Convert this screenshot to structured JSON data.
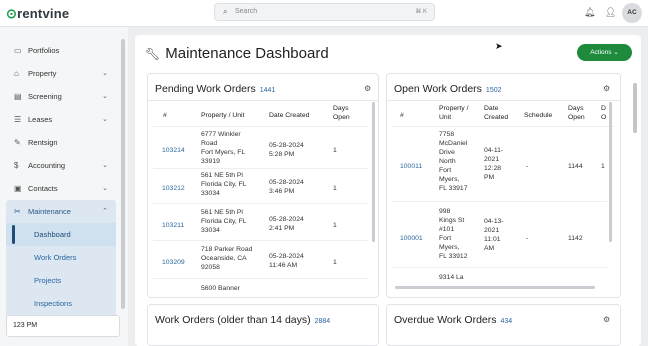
{
  "app": {
    "logo": "rentvine"
  },
  "search": {
    "placeholder": "Search",
    "shortcut": "⌘ K"
  },
  "user": {
    "initials": "AC"
  },
  "sidebar": {
    "items": [
      {
        "label": "Portfolios",
        "icon": "folder-icon"
      },
      {
        "label": "Property",
        "icon": "building-icon",
        "chevron": "⌄"
      },
      {
        "label": "Screening",
        "icon": "document-icon",
        "chevron": "⌄"
      },
      {
        "label": "Leases",
        "icon": "list-icon",
        "chevron": "⌄"
      },
      {
        "label": "Rentsign",
        "icon": "pen-icon"
      },
      {
        "label": "Accounting",
        "icon": "dollar-icon",
        "chevron": "⌄"
      },
      {
        "label": "Contacts",
        "icon": "contacts-icon",
        "chevron": "⌄"
      }
    ],
    "maintenance": {
      "label": "Maintenance",
      "chevron": "⌃",
      "subitems": [
        "Dashboard",
        "Work Orders",
        "Projects",
        "Inspections"
      ]
    },
    "time": "123 PM"
  },
  "main": {
    "title": "Maintenance Dashboard",
    "actions_label": "Actions",
    "actions_chevron": "⌄"
  },
  "cards": {
    "pending": {
      "title": "Pending Work Orders",
      "count": "1441",
      "columns": [
        "#",
        "Property / Unit",
        "Date Created",
        "Days Open"
      ],
      "rows": [
        {
          "id": "103214",
          "property": [
            "6777 Winkler",
            "Road",
            "Fort Myers, FL",
            "33919"
          ],
          "date": [
            "05-28-2024",
            "5:28 PM"
          ],
          "days": "1"
        },
        {
          "id": "103212",
          "property": [
            "561 NE 5th Pl",
            "Florida City, FL",
            "33034"
          ],
          "date": [
            "05-28-2024",
            "3:46 PM"
          ],
          "days": "1"
        },
        {
          "id": "103211",
          "property": [
            "561 NE 5th Pl",
            "Florida City, FL",
            "33034"
          ],
          "date": [
            "05-28-2024",
            "2:41 PM"
          ],
          "days": "1"
        },
        {
          "id": "103209",
          "property": [
            "718 Parker Road",
            "Oceanside, CA",
            "92058"
          ],
          "date": [
            "05-28-2024",
            "11:46 AM"
          ],
          "days": "1"
        },
        {
          "id": "",
          "property": [
            "5600 Banner"
          ],
          "date": [],
          "days": ""
        }
      ]
    },
    "open": {
      "title": "Open Work Orders",
      "count": "1502",
      "columns": [
        "#",
        "Property / Unit",
        "Date Created",
        "Schedule",
        "Days Open",
        "D O"
      ],
      "rows": [
        {
          "id": "100011",
          "property": [
            "7758",
            "McDaniel",
            "Drive",
            "North",
            "Fort",
            "Myers,",
            "FL 33917"
          ],
          "date": [
            "04-11-",
            "2021",
            "12:28",
            "PM"
          ],
          "schedule": "-",
          "days": "1144",
          "extra": "1"
        },
        {
          "id": "100001",
          "property": [
            "998",
            "Kings St",
            "#101",
            "Fort",
            "Myers,",
            "FL 33912"
          ],
          "date": [
            "04-13-",
            "2021",
            "11:01",
            "AM"
          ],
          "schedule": "-",
          "days": "1142",
          "extra": ""
        },
        {
          "id": "",
          "property": [
            "9314 La"
          ],
          "date": [],
          "schedule": "",
          "days": "",
          "extra": ""
        }
      ]
    },
    "older": {
      "title": "Work Orders (older than 14 days)",
      "count": "2884"
    },
    "overdue": {
      "title": "Overdue Work Orders",
      "count": "434"
    }
  }
}
